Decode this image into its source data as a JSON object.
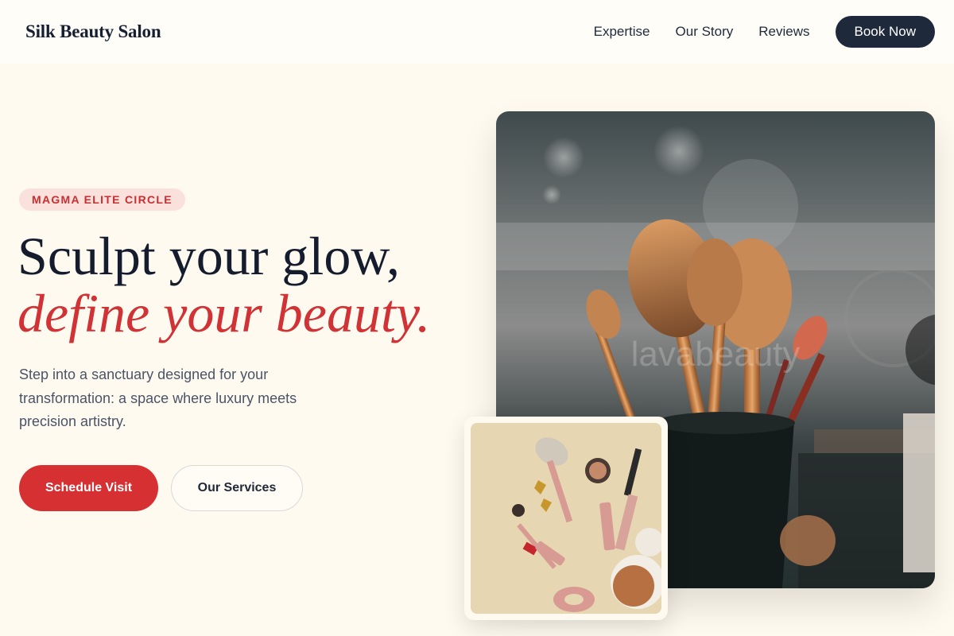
{
  "brand": {
    "name": "Silk Beauty Salon"
  },
  "nav": {
    "links": [
      {
        "label": "Expertise"
      },
      {
        "label": "Our Story"
      },
      {
        "label": "Reviews"
      }
    ],
    "cta_label": "Book Now"
  },
  "hero": {
    "badge": "MAGMA ELITE CIRCLE",
    "headline_line1": "Sculpt your glow,",
    "headline_line2": "define your beauty.",
    "intro": "Step into a sanctuary designed for your transformation: a space where luxury meets precision artistry.",
    "primary_button": "Schedule Visit",
    "secondary_button": "Our Services"
  },
  "images": {
    "main_photo_watermark": "lavabeauty"
  },
  "colors": {
    "accent": "#d63033",
    "navy": "#1e293b",
    "background": "#fefaef",
    "badge_bg": "#fbe1dc"
  }
}
